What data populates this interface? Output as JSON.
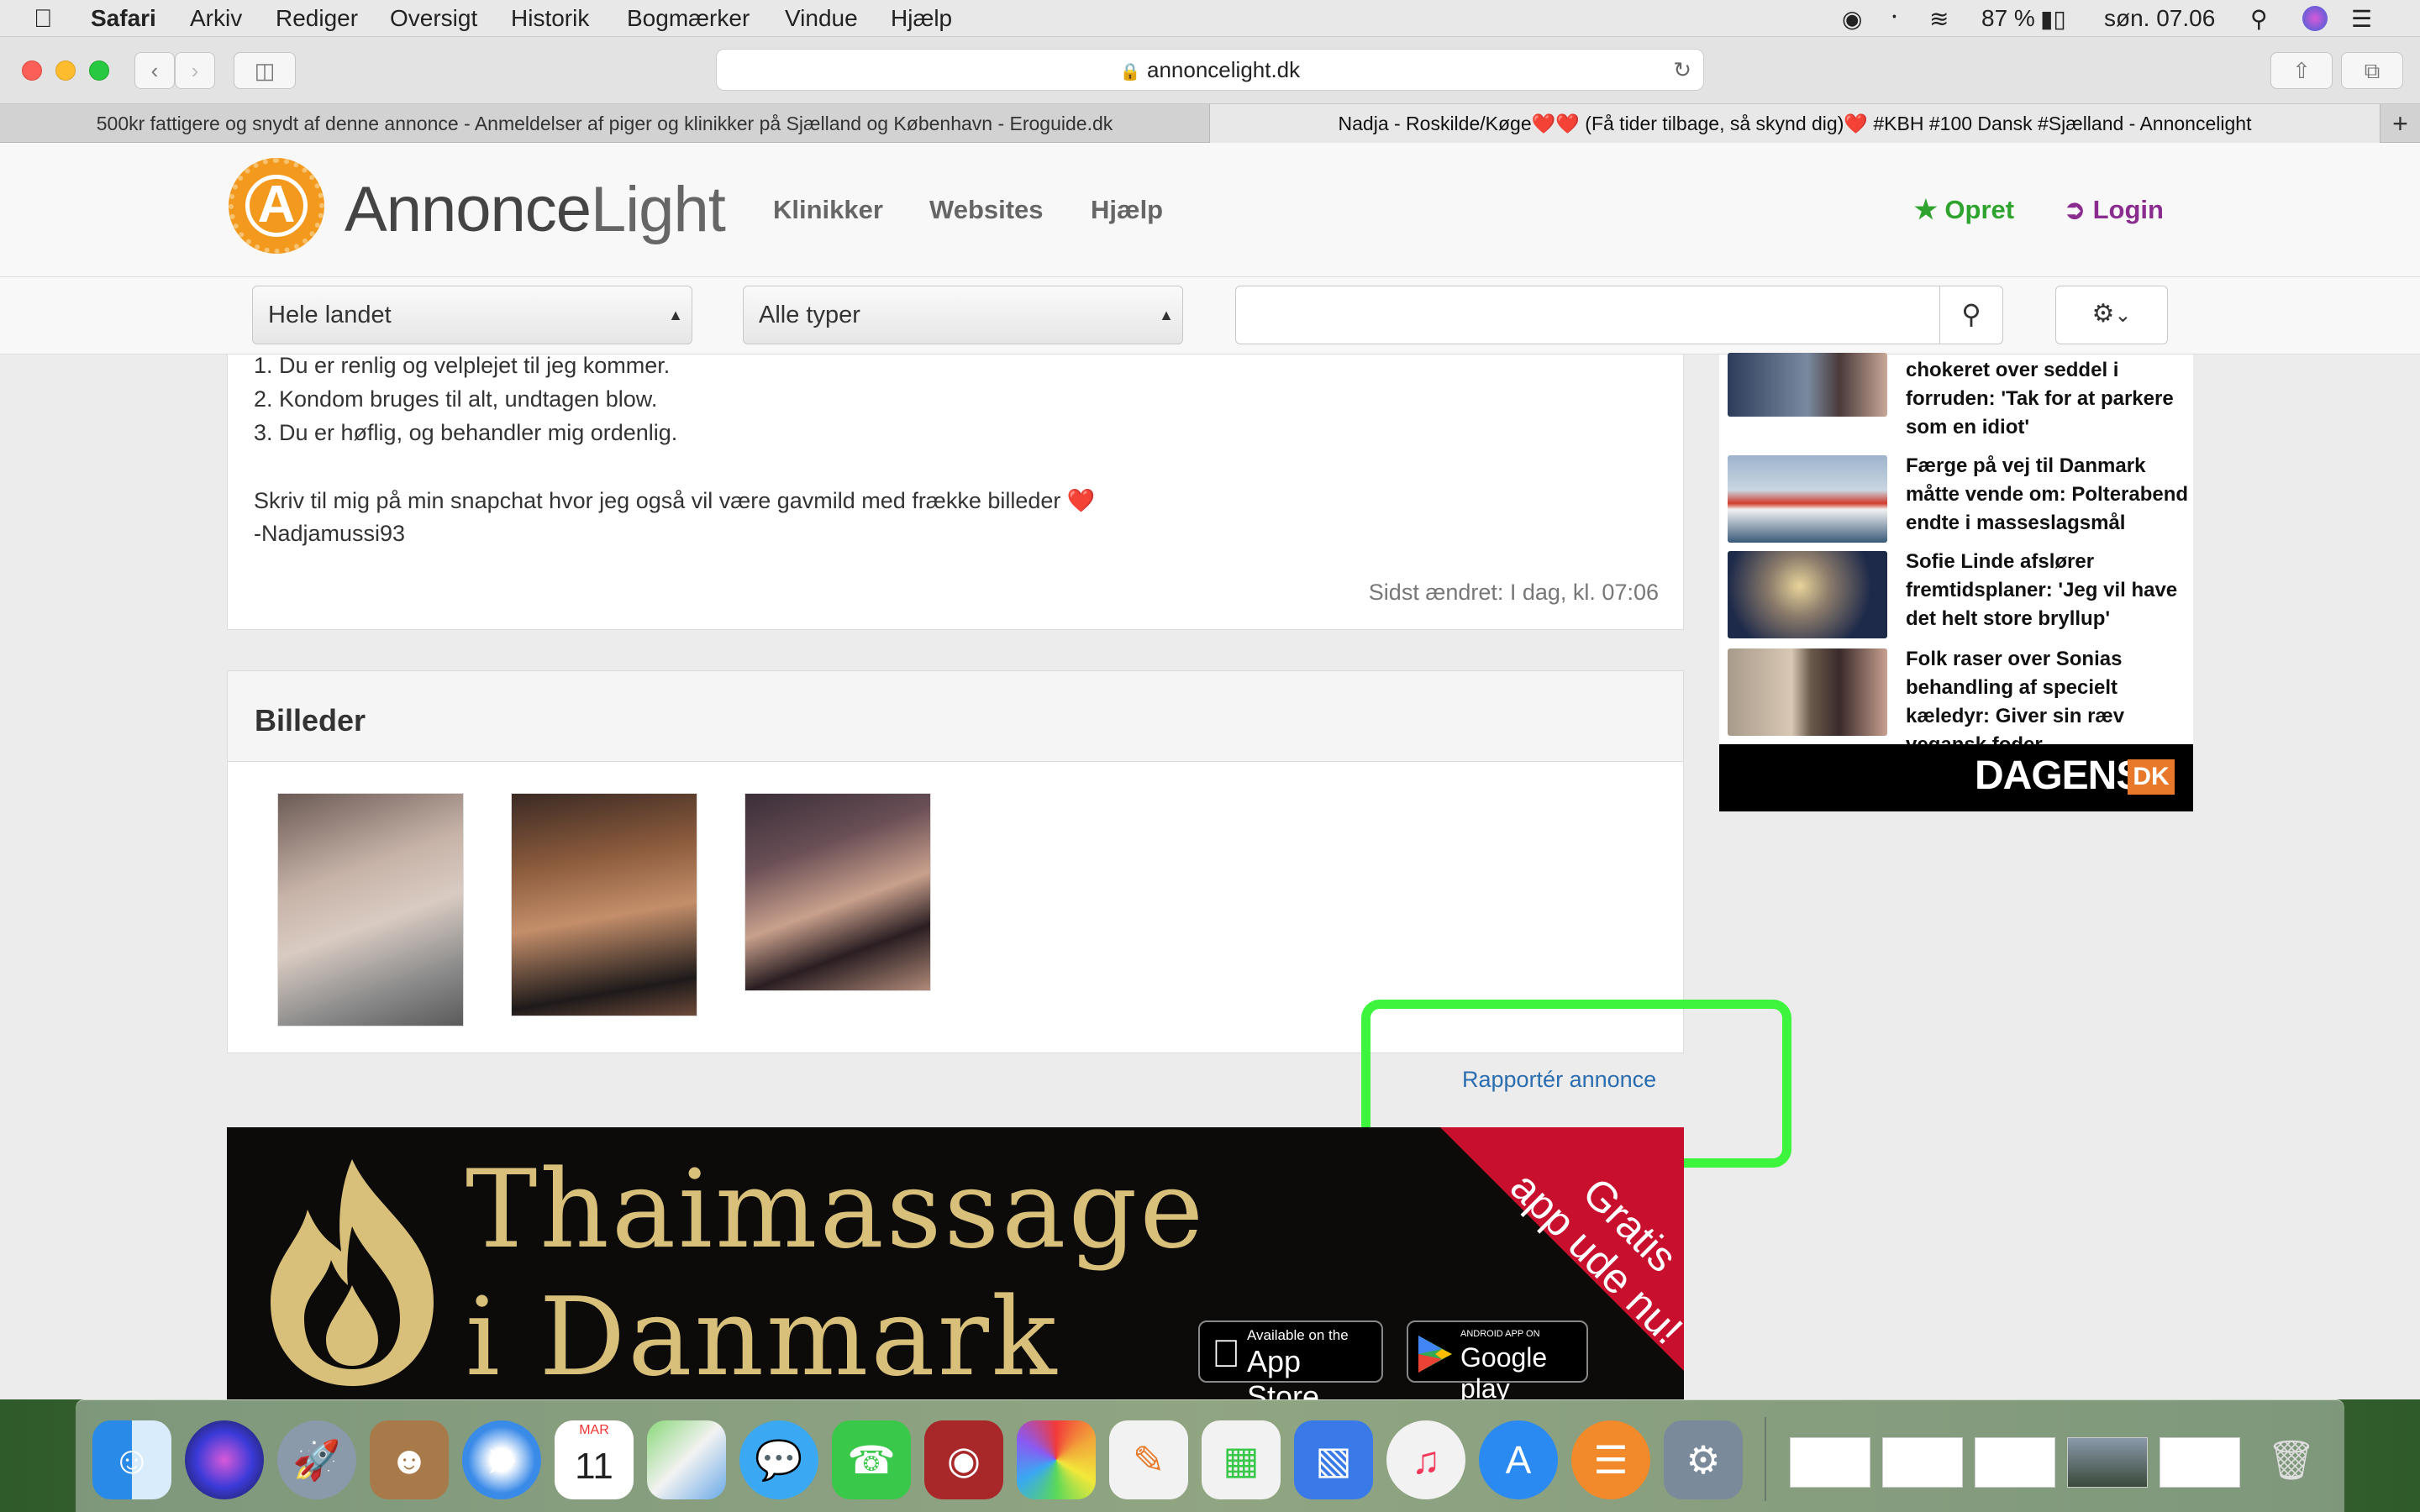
{
  "menubar": {
    "app": "Safari",
    "items": [
      "Arkiv",
      "Rediger",
      "Oversigt",
      "Historik",
      "Bogmærker",
      "Vindue",
      "Hjælp"
    ],
    "battery": "87 %",
    "clock": "søn. 07.06"
  },
  "browser": {
    "url": "annoncelight.dk",
    "tabs": [
      "500kr fattigere og snydt af denne annonce - Anmeldelser af piger og klinikker på Sjælland og København - Eroguide.dk",
      "Nadja - Roskilde/Køge❤️❤️ (Få tider tilbage, så skynd dig)❤️ #KBH #100 Dansk #Sjælland - Annoncelight"
    ],
    "new_tab": "+"
  },
  "site": {
    "logo_letter": "A",
    "logo_bold": "Annonce",
    "logo_light": "Light",
    "nav": [
      "Klinikker",
      "Websites",
      "Hjælp"
    ],
    "create_label": "Opret",
    "login_label": "Login"
  },
  "filters": {
    "region": "Hele landet",
    "type": "Alle typer",
    "search_value": ""
  },
  "ad": {
    "lines": [
      "1. Du er renlig og velplejet til jeg kommer.",
      "2. Kondom bruges til alt, undtagen blow.",
      "3. Du er høflig, og behandler mig ordenlig."
    ],
    "snap_line": "Skriv til mig på min snapchat hvor jeg også vil være gavmild med frække billeder ❤️",
    "signature": "-Nadjamussi93",
    "last_modified": "Sidst ændret: I dag, kl. 07:06",
    "images_heading": "Billeder",
    "report_link": "Rapportér annonce"
  },
  "news": [
    {
      "title": "chokeret over seddel i forruden: 'Tak for at parkere som en idiot'"
    },
    {
      "title": "Færge på vej til Danmark måtte vende om: Polterabend endte i masseslagsmål"
    },
    {
      "title": "Sofie Linde afslører fremtidsplaner: 'Jeg vil have det helt store bryllup'"
    },
    {
      "title": "Folk raser over Sonias behandling af specielt kæledyr: Giver sin ræv vegansk foder"
    }
  ],
  "news_brand": {
    "main": "DAGENS",
    "tag": "DK"
  },
  "banner": {
    "line1": "Thaimassage",
    "line2": "i Danmark",
    "ribbon_line1": "Gratis",
    "ribbon_line2": "app ude nu!",
    "appstore_small": "Available on the",
    "appstore_big": "App Store",
    "googleplay_small": "ANDROID APP ON",
    "googleplay_big": "Google play"
  },
  "dock": {
    "calendar_month": "MAR",
    "calendar_day": "11"
  },
  "colors": {
    "brand_orange": "#f39a1e",
    "create_green": "#2ea42e",
    "login_purple": "#8a2d8f",
    "link_blue": "#2a6db0",
    "highlight_green": "#3cf53c",
    "banner_gold": "#d8bf7a",
    "ribbon_red": "#c8102e"
  }
}
